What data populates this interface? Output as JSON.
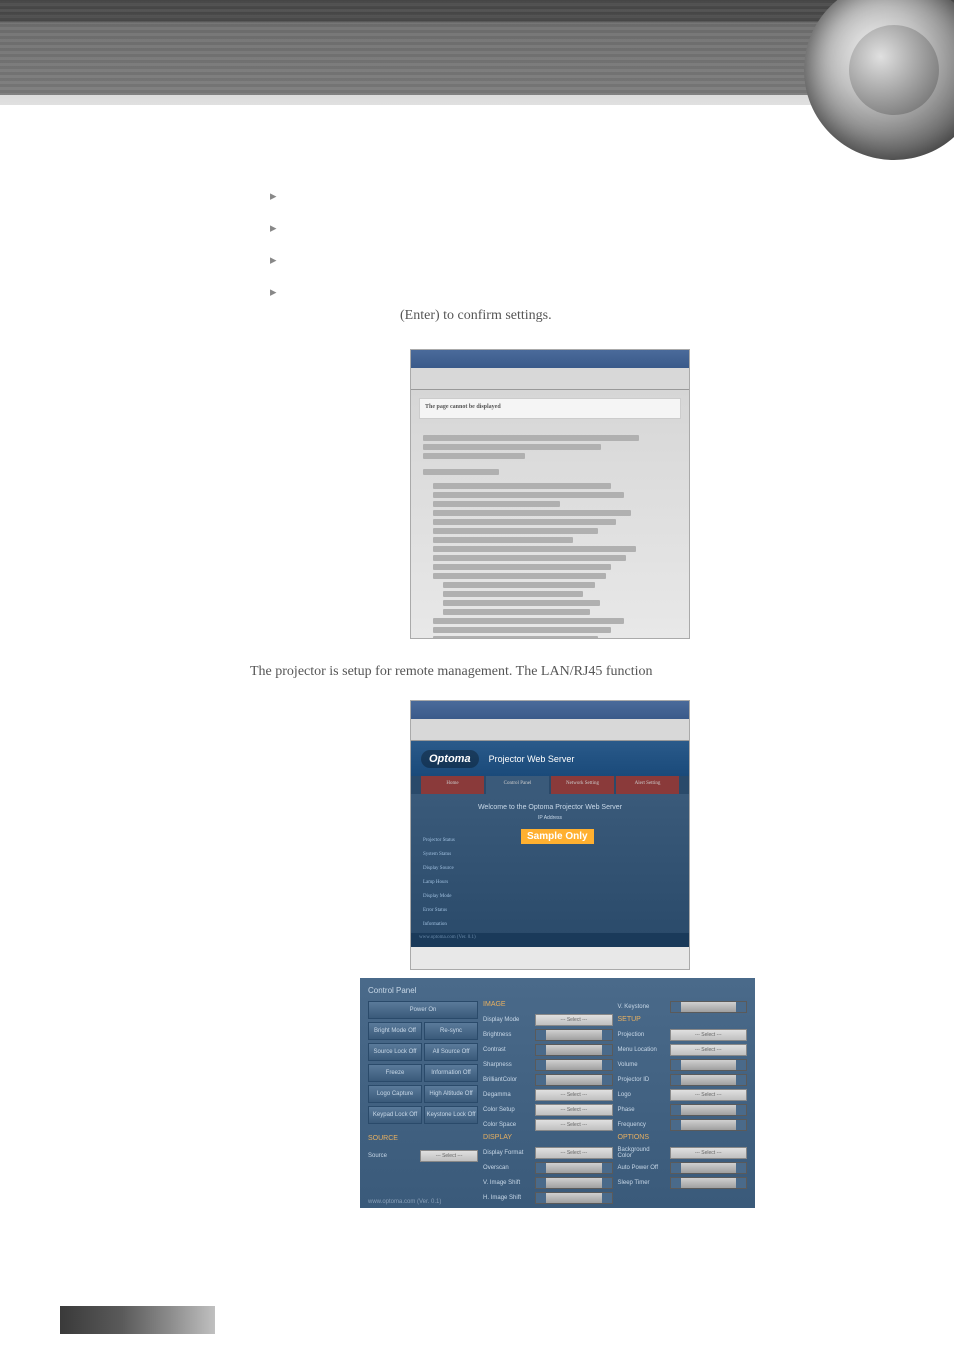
{
  "confirm_text": "(Enter) to confirm settings.",
  "description_text": "The projector is setup for remote management. The LAN/RJ45 function",
  "screenshot1": {
    "notice_title": "The page cannot be displayed",
    "notice_body": "The page is currently unavailable. The Web site might be experiencing technical difficulties, or you may need to adjust your browser settings."
  },
  "screenshot2": {
    "logo": "Optoma",
    "header_title": "Projector Web Server",
    "welcome": "Welcome to the Optoma Projector Web Server",
    "sample": "Sample Only",
    "tabs": [
      "Home",
      "Control Panel",
      "Network Setting",
      "Alert Setting"
    ],
    "info_rows": [
      "Projector Status",
      "System Status",
      "Display Source",
      "Lamp Hours",
      "Display Mode",
      "Error Status",
      "Information"
    ],
    "footer": "www.optoma.com (Ver. 0.1)"
  },
  "control_panel": {
    "title": "Control Panel",
    "left_buttons": {
      "power_on": "Power On",
      "bright_mode": "Bright Mode Off",
      "resync": "Re-sync",
      "source_lock": "Source Lock Off",
      "all_source": "All Source Off",
      "freeze": "Freeze",
      "information": "Information Off",
      "logo_capture": "Logo Capture",
      "high_altitude": "High Altitude Off",
      "keypad_lock": "Keypad Lock Off",
      "keystone_lock": "Keystone Lock Off"
    },
    "source_label": "SOURCE",
    "source_field": "Source",
    "image_section": "IMAGE",
    "image_rows": [
      "Display Mode",
      "Brightness",
      "Contrast",
      "Sharpness",
      "BrilliantColor",
      "Degamma",
      "Color Setup",
      "Color Space"
    ],
    "display_section": "DISPLAY",
    "display_rows": [
      "Display Format",
      "Overscan",
      "V. Image Shift",
      "H. Image Shift"
    ],
    "keystone_section": "V. Keystone",
    "setup_section": "SETUP",
    "setup_rows": [
      "Projection",
      "Menu Location",
      "Volume",
      "Projector ID",
      "Logo",
      "Phase",
      "Frequency"
    ],
    "options_section": "OPTIONS",
    "options_rows": [
      "Background Color",
      "Auto Power Off",
      "Sleep Timer"
    ],
    "select_placeholder": "--- Select ---",
    "footer": "www.optoma.com (Ver. 0.1)"
  }
}
